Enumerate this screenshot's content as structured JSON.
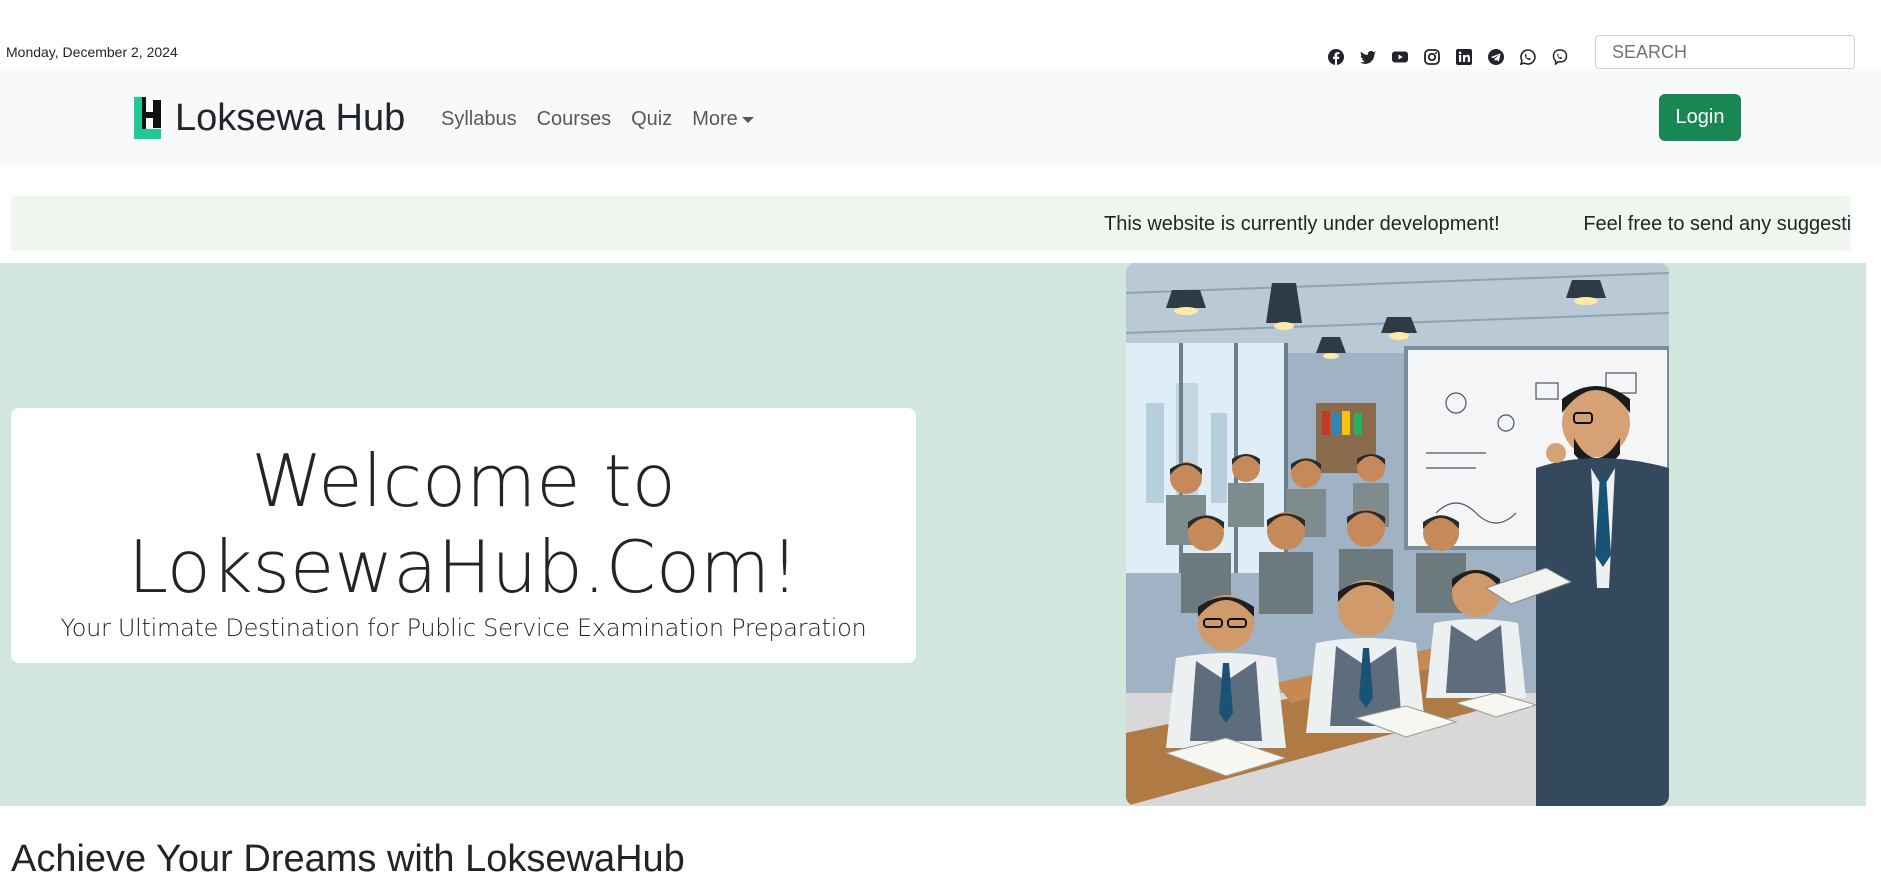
{
  "header": {
    "date": "Monday, December 2, 2024",
    "social_icons": [
      "facebook-icon",
      "twitter-icon",
      "youtube-icon",
      "instagram-icon",
      "linkedin-icon",
      "telegram-icon",
      "whatsapp-icon",
      "viber-icon"
    ],
    "search_placeholder": "SEARCH"
  },
  "navbar": {
    "brand": "Loksewa Hub",
    "links": [
      "Syllabus",
      "Courses",
      "Quiz",
      "More"
    ],
    "login_label": "Login"
  },
  "ticker": {
    "messages": [
      "This website is currently under development!",
      "Feel free to send any suggestic"
    ]
  },
  "hero": {
    "title_line1": "Welcome to",
    "title_line2": "LoksewaHub.Com!",
    "subtitle": "Your Ultimate Destination for Public Service Examination Preparation"
  },
  "section": {
    "title": "Achieve Your Dreams with LoksewaHub"
  },
  "colors": {
    "brand_green": "#198754",
    "hero_bg": "#d1e7dd",
    "ticker_bg": "#f0f7ef",
    "navbar_bg": "#f8f9fa"
  }
}
